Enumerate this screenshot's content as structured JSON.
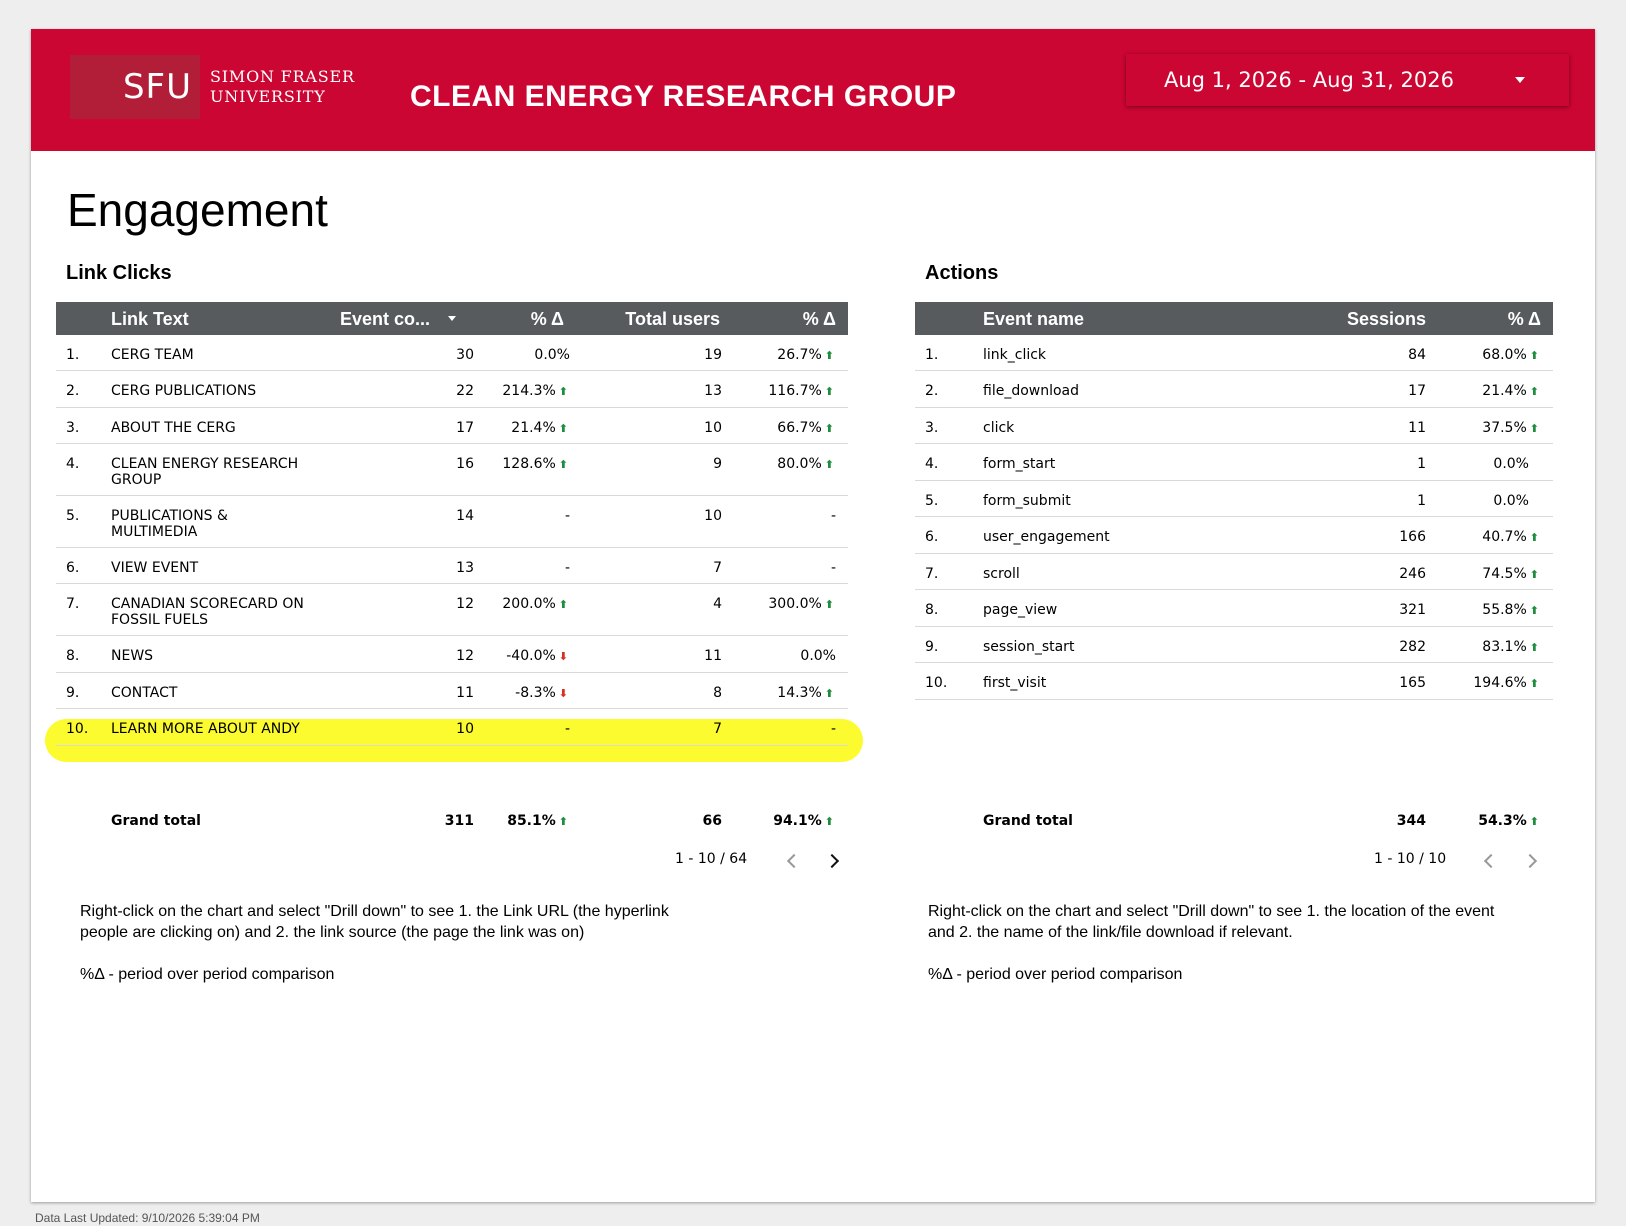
{
  "header": {
    "logo_mark": "SFU",
    "logo_name_line1": "SIMON FRASER",
    "logo_name_line2": "UNIVERSITY",
    "title": "CLEAN ENERGY RESEARCH GROUP",
    "date_range": "Aug 1, 2026 - Aug 31, 2026"
  },
  "page_title": "Engagement",
  "link_clicks": {
    "title": "Link Clicks",
    "columns": [
      "Link Text",
      "Event co...",
      "% Δ",
      "Total users",
      "% Δ"
    ],
    "rows": [
      {
        "n": "1.",
        "text": "CERG TEAM",
        "events": "30",
        "events_pct": "0.0%",
        "events_trend": "",
        "users": "19",
        "users_pct": "26.7%",
        "users_trend": "up"
      },
      {
        "n": "2.",
        "text": "CERG PUBLICATIONS",
        "events": "22",
        "events_pct": "214.3%",
        "events_trend": "up",
        "users": "13",
        "users_pct": "116.7%",
        "users_trend": "up"
      },
      {
        "n": "3.",
        "text": "ABOUT THE CERG",
        "events": "17",
        "events_pct": "21.4%",
        "events_trend": "up",
        "users": "10",
        "users_pct": "66.7%",
        "users_trend": "up"
      },
      {
        "n": "4.",
        "text": "CLEAN ENERGY RESEARCH GROUP",
        "events": "16",
        "events_pct": "128.6%",
        "events_trend": "up",
        "users": "9",
        "users_pct": "80.0%",
        "users_trend": "up"
      },
      {
        "n": "5.",
        "text": "PUBLICATIONS & MULTIMEDIA",
        "events": "14",
        "events_pct": "-",
        "events_trend": "",
        "users": "10",
        "users_pct": "-",
        "users_trend": ""
      },
      {
        "n": "6.",
        "text": "VIEW EVENT",
        "events": "13",
        "events_pct": "-",
        "events_trend": "",
        "users": "7",
        "users_pct": "-",
        "users_trend": ""
      },
      {
        "n": "7.",
        "text": "CANADIAN SCORECARD ON FOSSIL FUELS",
        "events": "12",
        "events_pct": "200.0%",
        "events_trend": "up",
        "users": "4",
        "users_pct": "300.0%",
        "users_trend": "up"
      },
      {
        "n": "8.",
        "text": "NEWS",
        "events": "12",
        "events_pct": "-40.0%",
        "events_trend": "down",
        "users": "11",
        "users_pct": "0.0%",
        "users_trend": ""
      },
      {
        "n": "9.",
        "text": "CONTACT",
        "events": "11",
        "events_pct": "-8.3%",
        "events_trend": "down",
        "users": "8",
        "users_pct": "14.3%",
        "users_trend": "up"
      },
      {
        "n": "10.",
        "text": "LEARN MORE ABOUT ANDY",
        "events": "10",
        "events_pct": "-",
        "events_trend": "",
        "users": "7",
        "users_pct": "-",
        "users_trend": ""
      }
    ],
    "grand_total": {
      "label": "Grand total",
      "events": "311",
      "events_pct": "85.1%",
      "users": "66",
      "users_pct": "94.1%"
    },
    "pager": "1 - 10 / 64",
    "note": "Right-click on the chart and select \"Drill down\" to see 1. the Link URL (the hyperlink people are clicking on) and 2. the link source (the page the link was on)",
    "note2": "%Δ - period over period comparison"
  },
  "actions": {
    "title": "Actions",
    "columns": [
      "Event name",
      "Sessions",
      "% Δ"
    ],
    "rows": [
      {
        "n": "1.",
        "name": "link_click",
        "sessions": "84",
        "pct": "68.0%",
        "trend": "up"
      },
      {
        "n": "2.",
        "name": "file_download",
        "sessions": "17",
        "pct": "21.4%",
        "trend": "up"
      },
      {
        "n": "3.",
        "name": "click",
        "sessions": "11",
        "pct": "37.5%",
        "trend": "up"
      },
      {
        "n": "4.",
        "name": "form_start",
        "sessions": "1",
        "pct": "0.0%",
        "trend": ""
      },
      {
        "n": "5.",
        "name": "form_submit",
        "sessions": "1",
        "pct": "0.0%",
        "trend": ""
      },
      {
        "n": "6.",
        "name": "user_engagement",
        "sessions": "166",
        "pct": "40.7%",
        "trend": "up"
      },
      {
        "n": "7.",
        "name": "scroll",
        "sessions": "246",
        "pct": "74.5%",
        "trend": "up"
      },
      {
        "n": "8.",
        "name": "page_view",
        "sessions": "321",
        "pct": "55.8%",
        "trend": "up"
      },
      {
        "n": "9.",
        "name": "session_start",
        "sessions": "282",
        "pct": "83.1%",
        "trend": "up"
      },
      {
        "n": "10.",
        "name": "first_visit",
        "sessions": "165",
        "pct": "194.6%",
        "trend": "up"
      }
    ],
    "grand_total": {
      "label": "Grand total",
      "sessions": "344",
      "pct": "54.3%"
    },
    "pager": "1 - 10 / 10",
    "note": "Right-click on the chart and select \"Drill down\" to see 1. the location of the event and 2. the name of the link/file download if relevant.",
    "note2": "%Δ - period over period comparison"
  },
  "footer": "Data Last Updated: 9/10/2026 5:39:04 PM",
  "icons": {
    "up": "arrow-up-icon",
    "down": "arrow-down-icon",
    "sort": "sort-desc-icon",
    "caret": "chevron-down-icon"
  },
  "colors": {
    "brand": "#cc0633",
    "header_bg": "#575b5e",
    "highlight": "#fbfb30",
    "up": "#1e8e3e",
    "down": "#d93025"
  }
}
